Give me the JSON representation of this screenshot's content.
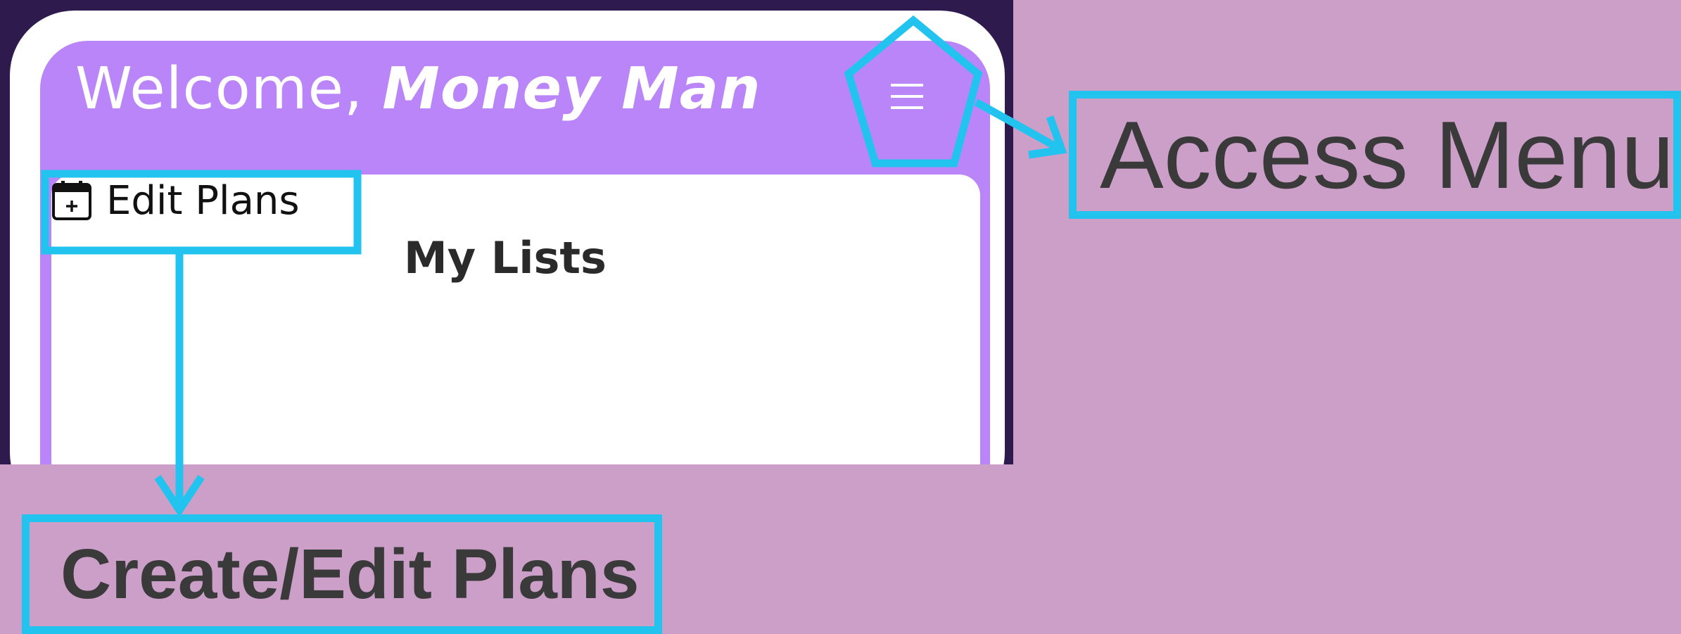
{
  "app": {
    "welcome_prefix": "Welcome, ",
    "user_name": "Money Man",
    "edit_plans_label": "Edit Plans",
    "section_title": "My Lists"
  },
  "annotations": {
    "access_menu": "Access Menu",
    "create_edit_plans": "Create/Edit Plans"
  },
  "colors": {
    "header_bg": "#b985f8",
    "backdrop": "#2e1a4d",
    "page_bg": "#cc9fc8",
    "highlight": "#22c4ef",
    "annotation_text": "#3a3a3a"
  },
  "icons": [
    "hamburger-menu-icon",
    "calendar-plus-icon"
  ]
}
